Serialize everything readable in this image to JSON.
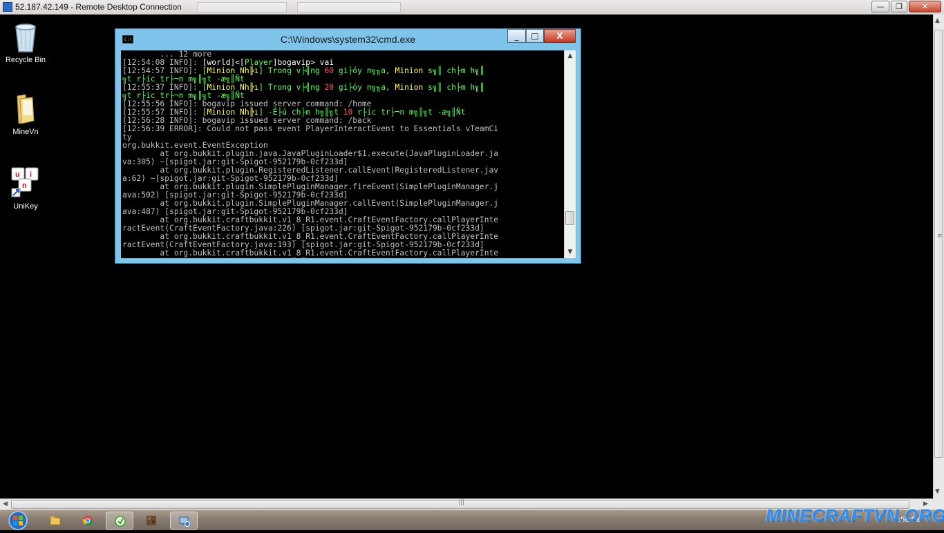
{
  "rdp": {
    "title": "52.187.42.149 - Remote Desktop Connection",
    "buttons": {
      "minimize": "—",
      "restore": "❐",
      "close": "✕"
    }
  },
  "desktop": {
    "icons": [
      {
        "label": "Recycle Bin",
        "icon": "recycle-bin-icon"
      },
      {
        "label": "MineVn",
        "icon": "folder-icon"
      },
      {
        "label": "UniKey",
        "icon": "unikey-icon"
      }
    ]
  },
  "cmd": {
    "title": "C:\\Windows\\system32\\cmd.exe",
    "buttons": {
      "minimize": "_",
      "maximize": "□",
      "close": "X"
    },
    "console_lines": [
      [
        {
          "t": "        ... 12 more",
          "c": "gray"
        }
      ],
      [
        {
          "t": "[12:54:08 INFO]: ",
          "c": "gray"
        },
        {
          "t": "[world]<[",
          "c": "white"
        },
        {
          "t": "Player",
          "c": "green"
        },
        {
          "t": "]bogavip> vai",
          "c": "white"
        }
      ],
      [
        {
          "t": "[12:54:57 INFO]: ",
          "c": "gray"
        },
        {
          "t": "[",
          "c": "green"
        },
        {
          "t": "Minion Nh╠ı",
          "c": "yellow"
        },
        {
          "t": "] Trong v├╣ng ",
          "c": "green"
        },
        {
          "t": "60",
          "c": "red"
        },
        {
          "t": " gi├óy n╗╖a, ",
          "c": "green"
        },
        {
          "t": "Minion",
          "c": "yellow"
        },
        {
          "t": " s╗║ ch├m h╗║",
          "c": "green"
        }
      ],
      [
        {
          "t": "╗t r├íc tr├¬n m╗║╗t -æ╗║Ñt",
          "c": "green"
        }
      ],
      [
        {
          "t": "[12:55:37 INFO]: ",
          "c": "gray"
        },
        {
          "t": "[",
          "c": "green"
        },
        {
          "t": "Minion Nh╠ı",
          "c": "yellow"
        },
        {
          "t": "] Trong v├╣ng ",
          "c": "green"
        },
        {
          "t": "20",
          "c": "red"
        },
        {
          "t": " gi├óy n╗╖a, ",
          "c": "green"
        },
        {
          "t": "Minion",
          "c": "yellow"
        },
        {
          "t": " s╗║ ch├m h╗║",
          "c": "green"
        }
      ],
      [
        {
          "t": "╗t r├íc tr├¬n m╗║╗t -æ╗║Ñt",
          "c": "green"
        }
      ],
      [
        {
          "t": "[12:55:56 INFO]: bogavip issued server command: /home",
          "c": "gray"
        }
      ],
      [
        {
          "t": "[12:55:57 INFO]: ",
          "c": "gray"
        },
        {
          "t": "[",
          "c": "green"
        },
        {
          "t": "Minion Nh╠ı",
          "c": "yellow"
        },
        {
          "t": "] -É├ú ch├m h╗║╗t ",
          "c": "green"
        },
        {
          "t": "10",
          "c": "red"
        },
        {
          "t": " r├íc tr├¬n m╗║╗t -æ╗║Ñt",
          "c": "green"
        }
      ],
      [
        {
          "t": "[12:56:28 INFO]: bogavip issued server command: /back",
          "c": "gray"
        }
      ],
      [
        {
          "t": "[12:56:39 ERROR]: Could not pass event PlayerInteractEvent to Essentials vTeamCi",
          "c": "gray"
        }
      ],
      [
        {
          "t": "ty",
          "c": "gray"
        }
      ],
      [
        {
          "t": "org.bukkit.event.EventException",
          "c": "gray"
        }
      ],
      [
        {
          "t": "        at org.bukkit.plugin.java.JavaPluginLoader$1.execute(JavaPluginLoader.ja",
          "c": "gray"
        }
      ],
      [
        {
          "t": "va:305) ~[spigot.jar:git-Spigot-952179b-0cf233d]",
          "c": "gray"
        }
      ],
      [
        {
          "t": "        at org.bukkit.plugin.RegisteredListener.callEvent(RegisteredListener.jav",
          "c": "gray"
        }
      ],
      [
        {
          "t": "a:62) ~[spigot.jar:git-Spigot-952179b-0cf233d]",
          "c": "gray"
        }
      ],
      [
        {
          "t": "        at org.bukkit.plugin.SimplePluginManager.fireEvent(SimplePluginManager.j",
          "c": "gray"
        }
      ],
      [
        {
          "t": "ava:502) [spigot.jar:git-Spigot-952179b-0cf233d]",
          "c": "gray"
        }
      ],
      [
        {
          "t": "        at org.bukkit.plugin.SimplePluginManager.callEvent(SimplePluginManager.j",
          "c": "gray"
        }
      ],
      [
        {
          "t": "ava:487) [spigot.jar:git-Spigot-952179b-0cf233d]",
          "c": "gray"
        }
      ],
      [
        {
          "t": "        at org.bukkit.craftbukkit.v1_8_R1.event.CraftEventFactory.callPlayerInte",
          "c": "gray"
        }
      ],
      [
        {
          "t": "ractEvent(CraftEventFactory.java:226) [spigot.jar:git-Spigot-952179b-0cf233d]",
          "c": "gray"
        }
      ],
      [
        {
          "t": "        at org.bukkit.craftbukkit.v1_8_R1.event.CraftEventFactory.callPlayerInte",
          "c": "gray"
        }
      ],
      [
        {
          "t": "ractEvent(CraftEventFactory.java:193) [spigot.jar:git-Spigot-952179b-0cf233d]",
          "c": "gray"
        }
      ],
      [
        {
          "t": "        at org.bukkit.craftbukkit.v1_8_R1.event.CraftEventFactory.callPlayerInte",
          "c": "gray"
        }
      ]
    ],
    "colors": {
      "white": "#ffffff",
      "gray": "#c0c0c0",
      "green": "#55ff55",
      "yellow": "#ffff55",
      "red": "#ff5555"
    }
  },
  "taskbar": {
    "items": [
      {
        "icon": "windows-explorer-icon",
        "active": false
      },
      {
        "icon": "chrome-icon",
        "active": false
      },
      {
        "icon": "minecraft-launcher-icon",
        "active": true
      },
      {
        "icon": "minecraft-block-icon",
        "active": false
      },
      {
        "icon": "remote-desktop-icon",
        "active": true
      }
    ],
    "clock": "7:59 PM"
  },
  "watermark": "MINECRAFTVN.ORG"
}
